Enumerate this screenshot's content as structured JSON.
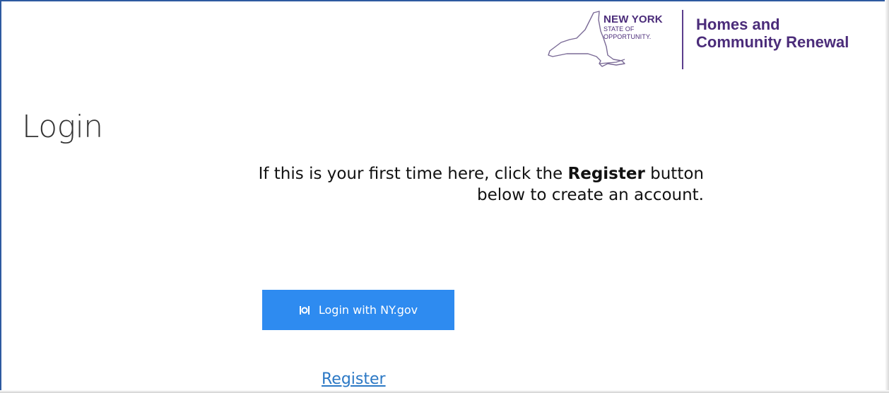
{
  "header": {
    "logo": {
      "state_name": "NEW YORK",
      "state_tagline_line1": "STATE OF",
      "state_tagline_line2": "OPPORTUNITY.",
      "agency_line1": "Homes and",
      "agency_line2": "Community Renewal",
      "brand_color": "#4b2c7a",
      "icon": "new-york-state-map-icon"
    }
  },
  "main": {
    "title": "Login",
    "instructions": {
      "line1_prefix": "If this is your first time here, click the ",
      "line1_bold": "Register",
      "line1_suffix": " button",
      "line2": "below to create an account."
    },
    "login_button": {
      "label": "Login with NY.gov",
      "icon": "ny-gov-login-icon",
      "color": "#2e8bf0"
    },
    "register_link": {
      "label": "Register",
      "color": "#2b78c5"
    }
  }
}
